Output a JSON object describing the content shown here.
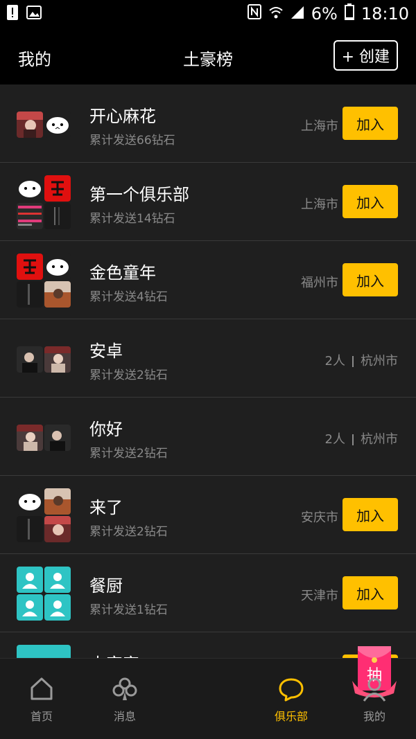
{
  "status_bar": {
    "battery": "6%",
    "time": "18:10"
  },
  "header": {
    "left": "我的",
    "title": "土豪榜",
    "create": "+ 创建"
  },
  "clubs": [
    {
      "name": "开心麻花",
      "sent": "累计发送66钻石",
      "city": "上海市",
      "join": "加入"
    },
    {
      "name": "第一个俱乐部",
      "sent": "累计发送14钻石",
      "city": "上海市",
      "join": "加入"
    },
    {
      "name": "金色童年",
      "sent": "累计发送4钻石",
      "city": "福州市",
      "join": "加入"
    },
    {
      "name": "安卓",
      "sent": "累计发送2钻石",
      "members": "2人",
      "city": "杭州市"
    },
    {
      "name": "你好",
      "sent": "累计发送2钻石",
      "members": "2人",
      "city": "杭州市"
    },
    {
      "name": "来了",
      "sent": "累计发送2钻石",
      "city": "安庆市",
      "join": "加入"
    },
    {
      "name": "餐厨",
      "sent": "累计发送1钻石",
      "city": "天津市",
      "join": "加入"
    },
    {
      "name": "大富家",
      "sent": "",
      "city": "",
      "join": ""
    }
  ],
  "tabs": [
    {
      "label": "首页",
      "icon": "home-icon"
    },
    {
      "label": "消息",
      "icon": "clover-icon"
    },
    {
      "label": "抽",
      "icon": "lottery-redpacket-icon"
    },
    {
      "label": "俱乐部",
      "icon": "chat-bubble-icon",
      "active": true
    },
    {
      "label": "我的",
      "icon": "person-icon"
    }
  ],
  "colors": {
    "accent": "#ffc000",
    "background": "#1f1f1f",
    "bar": "#000000",
    "muted": "#8a8a8a",
    "teal": "#2ec4c4"
  }
}
